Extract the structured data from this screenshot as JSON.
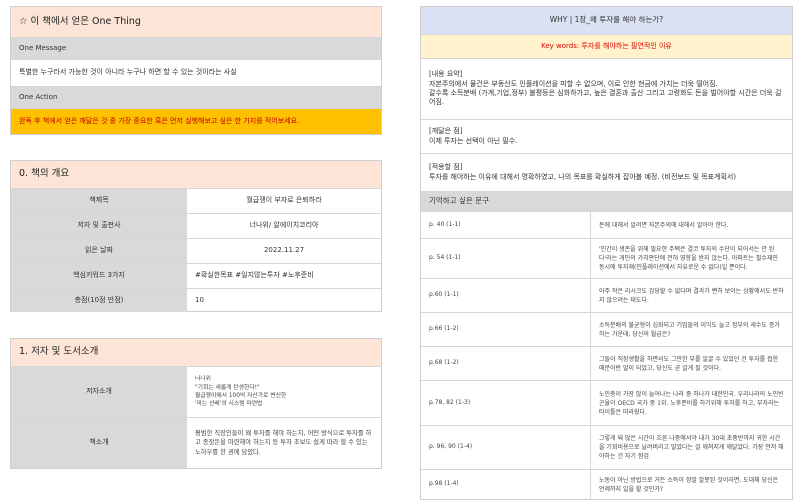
{
  "one_thing": {
    "title": "☆ 이 책에서 얻은 One Thing",
    "message_label": "One Message",
    "message_text": "특별한 누구라서 가능한 것이 아니라 누구나 하면 할 수 있는 것이라는 사실",
    "action_label": "One Action",
    "action_text": "완독 후 책에서 얻은 깨달은 것 중 가장 중요한 혹은 먼저 실행해보고 싶은 한 가지를 적어보세요."
  },
  "overview": {
    "title": "0. 책의 개요",
    "rows": [
      {
        "label": "책제목",
        "value": "월급쟁이 부자로 은퇴하라"
      },
      {
        "label": "저자 및 출판사",
        "value": "너나위/ 알에이치코리아"
      },
      {
        "label": "읽은 날짜",
        "value": "2022.11.27"
      },
      {
        "label": "핵심키워드 3가지",
        "value": "#확실한목표 #일지않는투자 #노후준비"
      },
      {
        "label": "총점(10점 만점)",
        "value": "10"
      }
    ]
  },
  "author": {
    "title": "1. 저자 및 도서소개",
    "author_label": "저자소개",
    "author_lines": [
      "너나위",
      "\"기회는 새롭게 탄생한다!\"",
      "월급쟁이에서 100억 자산가로 변신한",
      "'마는 선배'의 시스템 마련법"
    ],
    "book_label": "책소개",
    "book_text": "평범한 직장인들이 왜 투자를 해야 하는지, 어떤 방식으로 투자를 하고 종잣돈을 마련해야 하는지 등 투자 초보도 쉽게 따라 할 수 있는 노하우를 한 권에 담았다."
  },
  "why": {
    "title": "WHY | 1장_왜 투자를 해야 하는가?",
    "keywords": "Key words: 투자를 해야하는 필연적인 이유",
    "summary_label": "[내용 요약]",
    "summary_lines": [
      "자본주의에서 물건은 부동산도 인플레이션을 피할 수 없으며, 이로 인한 현금에 가치는 더욱 떨어짐.",
      "갈수록 소득분배 (가계,기업,정부) 불평등은 심화하가고, 높은 결혼과 출산 그리고 고령화도 돈을 벌어야할 시간은 더욱 길어짐."
    ],
    "realize_label": "[깨달은 점]",
    "realize_text": "이제 투자는 선택이 아닌 필수.",
    "apply_label": "[적용할 점]",
    "apply_text": "투자를 해야하는 이유에 대해서 명확하였고, 나의 목표를 확실하게 잡아볼 예정. (비전보드 및 목표계획서)",
    "quotes_title": "기억하고 싶은 문구",
    "quotes": [
      {
        "page": "p. 40 (1-1)",
        "text": "돈에 대해서 알려면 자본주의에 대해서 알아야 한다."
      },
      {
        "page": "p. 54 (1-1)",
        "text": "'인간이 생존을 위해 필요한 주택은 결코 투자의 수단이 되어서는 안 된다'라는 개인의 가치판단에 전혀 영향을 받지 않는다. 아파트는 필수재인 동시에 투자재(인플레이션에서 자유로운 수 없다)일 뿐이다."
      },
      {
        "page": "p.60 (1-1)",
        "text": "아주 작은 리시크도 감당할 수 없다며 결과가 뻔히 보이는 상황에서도 반하지 않으려는 태도다."
      },
      {
        "page": "p.66 (1-2)",
        "text": "소득분배의 불균형이 심화되고 기업들의 이익도 늘고 정부의 세수도 증가하는 가운데, 당신의 월급은?"
      },
      {
        "page": "p.68 (1-2)",
        "text": "그들이 직장생활을 하면서도 그만한 부를 일굴 수 있었던 건 투자를 접한 때문이란 말이 되었고, 당신도 곧 알게 될 것이다."
      },
      {
        "page": "p.78, 82 (1-3)",
        "text": "노인층이 가장 많이 늘어나는 나라 중 하나가 대한민국. 우리나라의 노인빈곤율이 OECD 국가 중 1위. 노후준비를 하기위해 투자를 하고, 부자라는 타이틀은 따라왔다."
      },
      {
        "page": "p. 96, 90  (1-4)",
        "text": "그렇게 돼 많은 시간이 흐른 나중에서야 내가 30대 초중반까지 귀한 시간을 기회비용으로 날려버리고 말았다는 걸 깨쳐지게 깨달았다. 가장 먼저 해야하는 건 자기 점검"
      },
      {
        "page": "p.98 (1-4)",
        "text": "노동이 아닌 방법으로 거든 소득이 정말 잘못된 것이라면, 도대체 당신은 언제까지 일을 할 것인가?"
      }
    ]
  }
}
